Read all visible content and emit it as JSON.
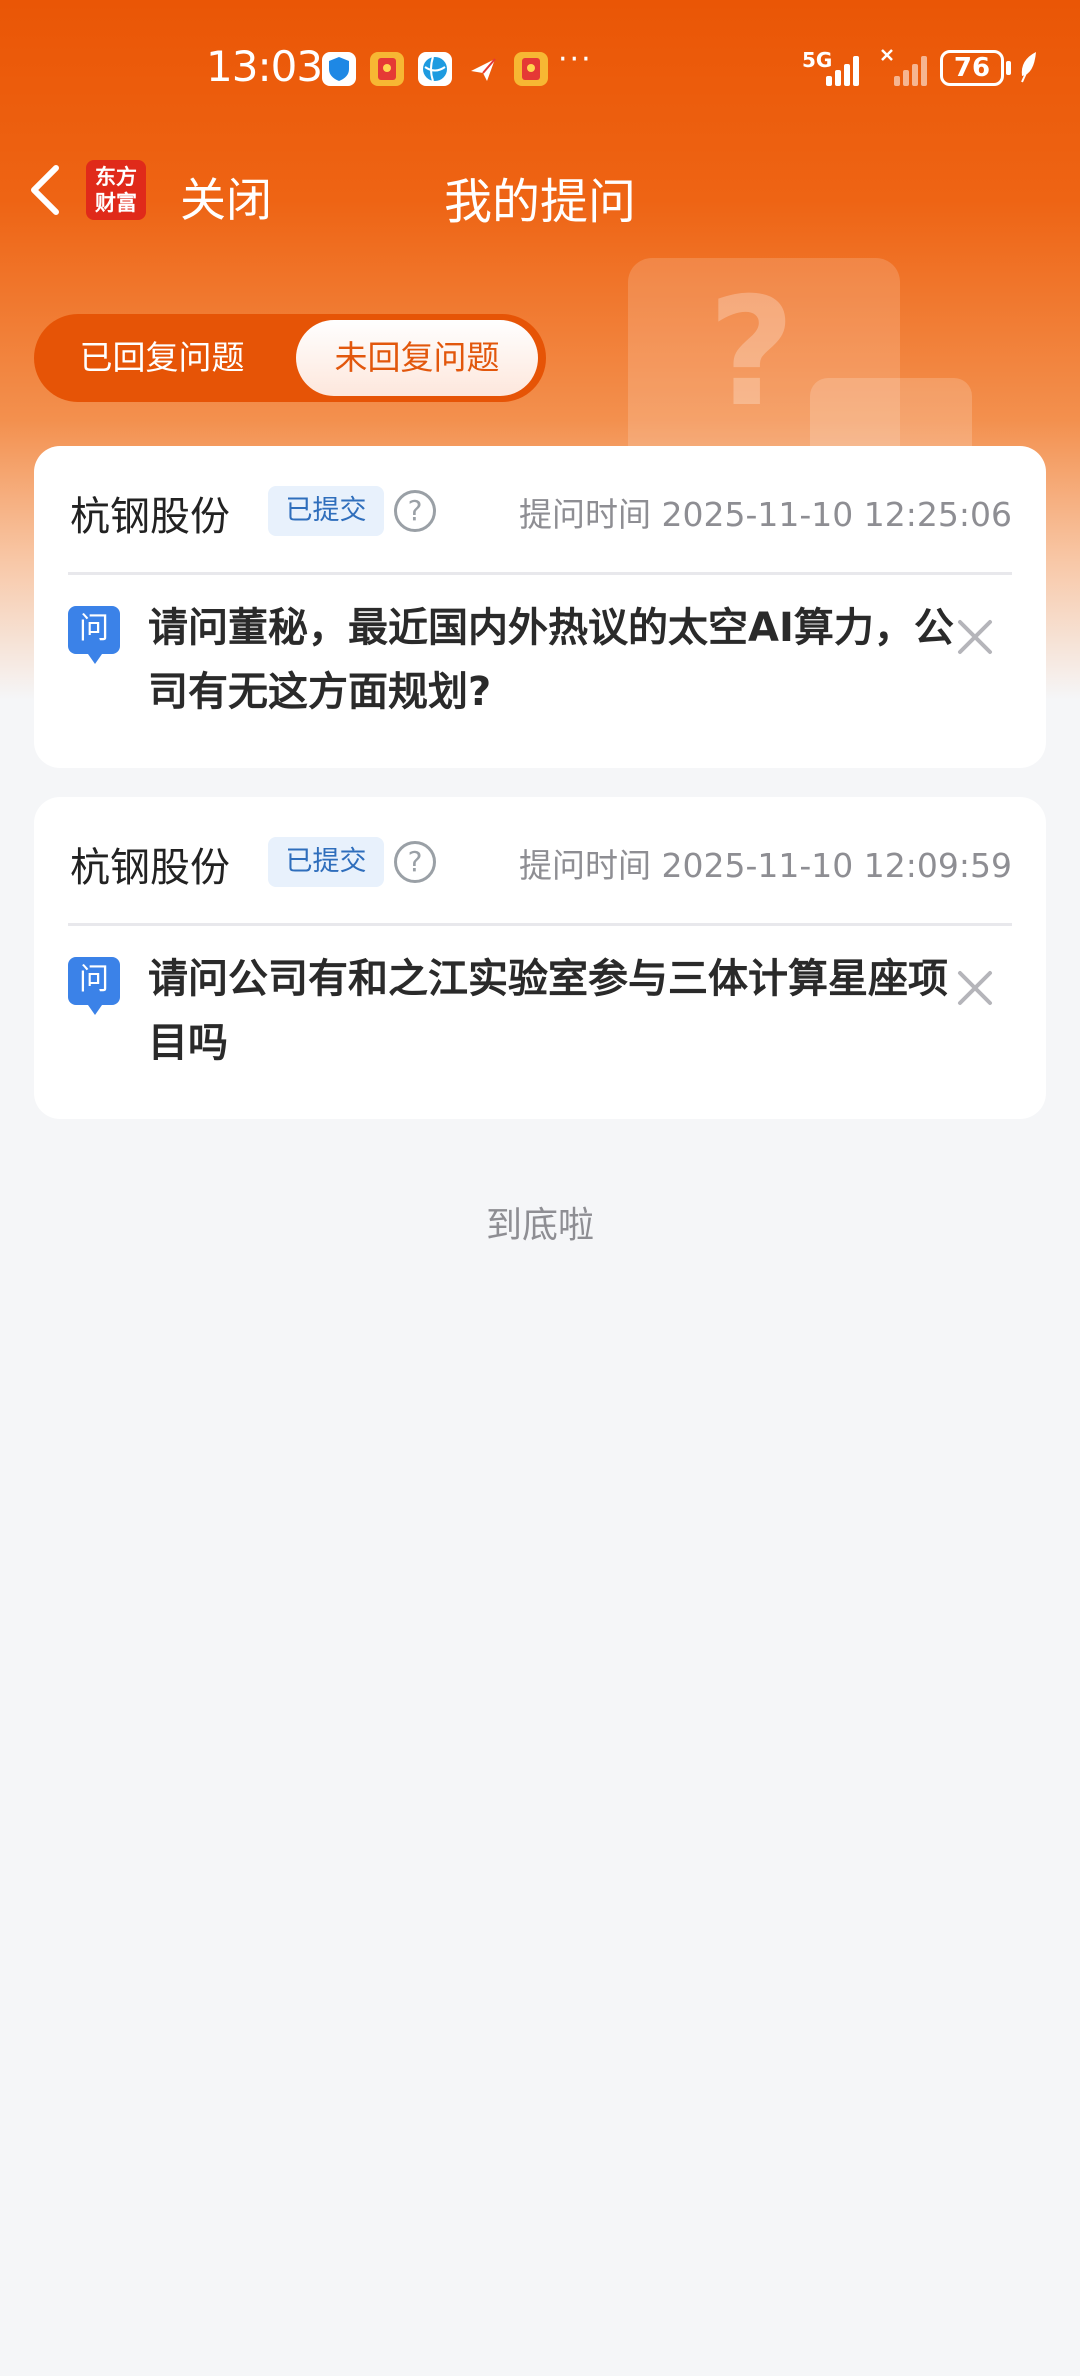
{
  "status_bar": {
    "time": "13:03",
    "more": "···",
    "network": "5G",
    "battery": "76",
    "icons": [
      "shield-icon",
      "red-envelope-icon",
      "globe-icon",
      "paper-plane-icon",
      "red-envelope-icon"
    ]
  },
  "nav": {
    "back_icon": "chevron-left-icon",
    "logo_text": "东方\n财富",
    "close_label": "关闭",
    "title": "我的提问"
  },
  "tabs": {
    "replied": "已回复问题",
    "unreplied": "未回复问题",
    "active": "unreplied"
  },
  "questions": [
    {
      "company": "杭钢股份",
      "status": "已提交",
      "time_label": "提问时间 2025-11-10 12:25:06",
      "q_badge": "问",
      "text": "请问董秘，最近国内外热议的太空AI算力，公司有无这方面规划?"
    },
    {
      "company": "杭钢股份",
      "status": "已提交",
      "time_label": "提问时间 2025-11-10 12:09:59",
      "q_badge": "问",
      "text": "请问公司有和之江实验室参与三体计算星座项目吗"
    }
  ],
  "help_symbol": "?",
  "end_label": "到底啦",
  "colors": {
    "brand_orange": "#ea5606",
    "tab_active_text": "#e2570c",
    "badge_blue": "#2f6ebc",
    "question_icon_blue": "#3b82e8",
    "background": "#f5f6f8"
  }
}
